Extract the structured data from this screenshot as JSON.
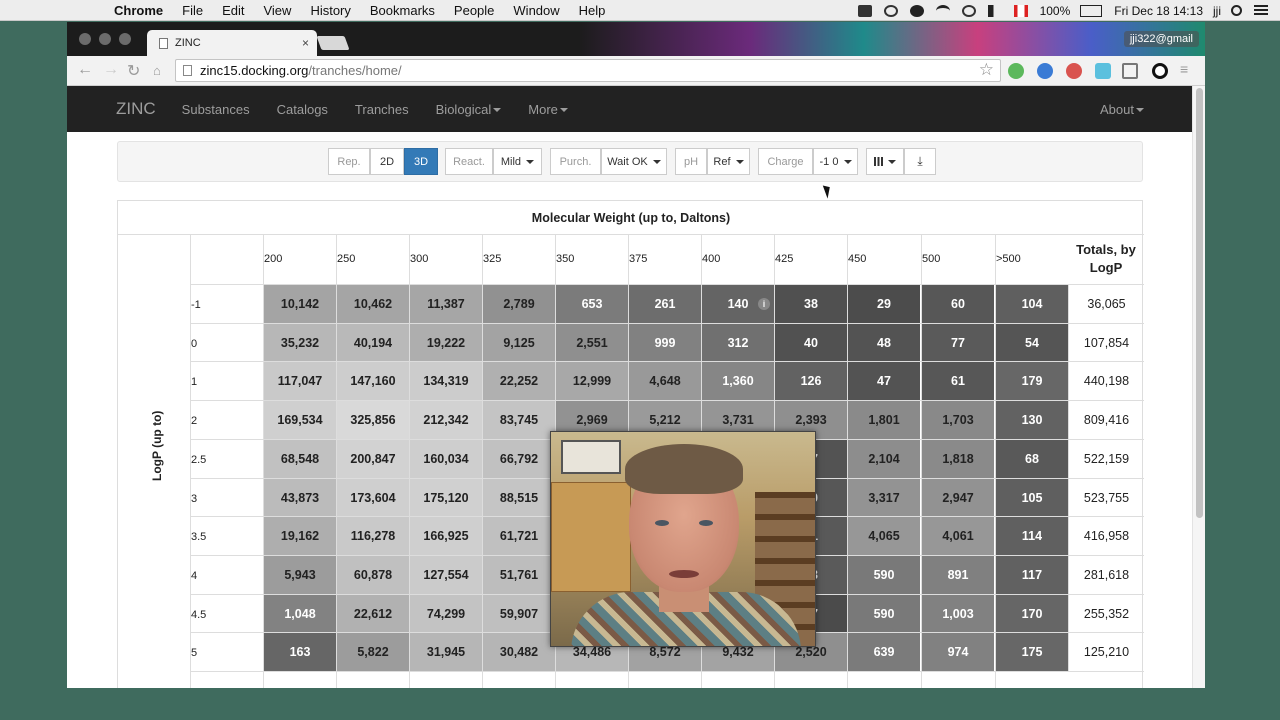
{
  "menubar": {
    "app": "Chrome",
    "items": [
      "File",
      "Edit",
      "View",
      "History",
      "Bookmarks",
      "People",
      "Window",
      "Help"
    ],
    "battery": "100%",
    "clock": "Fri Dec 18  14:13",
    "user": "jji"
  },
  "browser": {
    "tab_title": "ZINC",
    "url_host": "zinc15.docking.org",
    "url_path": "/tranches/home/",
    "account": "jji322@gmail"
  },
  "site": {
    "brand": "ZINC",
    "nav": [
      "Substances",
      "Catalogs",
      "Tranches",
      "Biological",
      "More"
    ],
    "nav_right": "About"
  },
  "filters": {
    "rep_label": "Rep.",
    "rep_2d": "2D",
    "rep_3d": "3D",
    "react_label": "React.",
    "react_value": "Mild",
    "purch_label": "Purch.",
    "purch_value": "Wait OK",
    "ph_label": "pH",
    "ph_value": "Ref",
    "charge_label": "Charge",
    "charge_value": "-1 0"
  },
  "table": {
    "title": "Molecular Weight (up to, Daltons)",
    "row_axis": "LogP (up to)",
    "totals_header_1": "Totals, by",
    "totals_header_2": "LogP",
    "columns": [
      "200",
      "250",
      "300",
      "325",
      "350",
      "375",
      "400",
      "425",
      "450",
      "500",
      ">500"
    ],
    "rows": [
      {
        "logp": "-1",
        "values": [
          "10,142",
          "10,462",
          "11,387",
          "2,789",
          "653",
          "261",
          "140",
          "38",
          "29",
          "60",
          "104"
        ],
        "total": "36,065"
      },
      {
        "logp": "0",
        "values": [
          "35,232",
          "40,194",
          "19,222",
          "9,125",
          "2,551",
          "999",
          "312",
          "40",
          "48",
          "77",
          "54"
        ],
        "total": "107,854"
      },
      {
        "logp": "1",
        "values": [
          "117,047",
          "147,160",
          "134,319",
          "22,252",
          "12,999",
          "4,648",
          "1,360",
          "126",
          "47",
          "61",
          "179"
        ],
        "total": "440,198"
      },
      {
        "logp": "2",
        "values": [
          "169,534",
          "325,856",
          "212,342",
          "83,745",
          "2,969",
          "5,212",
          "3,731",
          "2,393",
          "1,801",
          "1,703",
          "130"
        ],
        "total": "809,416"
      },
      {
        "logp": "2.5",
        "values": [
          "68,548",
          "200,847",
          "160,034",
          "66,792",
          "",
          "",
          "",
          "47",
          "2,104",
          "1,818",
          "68"
        ],
        "total": "522,159"
      },
      {
        "logp": "3",
        "values": [
          "43,873",
          "173,604",
          "175,120",
          "88,515",
          "",
          "",
          "",
          "60",
          "3,317",
          "2,947",
          "105"
        ],
        "total": "523,755"
      },
      {
        "logp": "3.5",
        "values": [
          "19,162",
          "116,278",
          "166,925",
          "61,721",
          "",
          "",
          "",
          "71",
          "4,065",
          "4,061",
          "114"
        ],
        "total": "416,958"
      },
      {
        "logp": "4",
        "values": [
          "5,943",
          "60,878",
          "127,554",
          "51,761",
          "",
          "",
          "",
          "73",
          "590",
          "891",
          "117"
        ],
        "total": "281,618"
      },
      {
        "logp": "4.5",
        "values": [
          "1,048",
          "22,612",
          "74,299",
          "59,907",
          "",
          "",
          "",
          "27",
          "590",
          "1,003",
          "170"
        ],
        "total": "255,352"
      },
      {
        "logp": "5",
        "values": [
          "163",
          "5,822",
          "31,945",
          "30,482",
          "34,486",
          "8,572",
          "9,432",
          "2,520",
          "639",
          "974",
          "175"
        ],
        "total": "125,210"
      }
    ]
  }
}
